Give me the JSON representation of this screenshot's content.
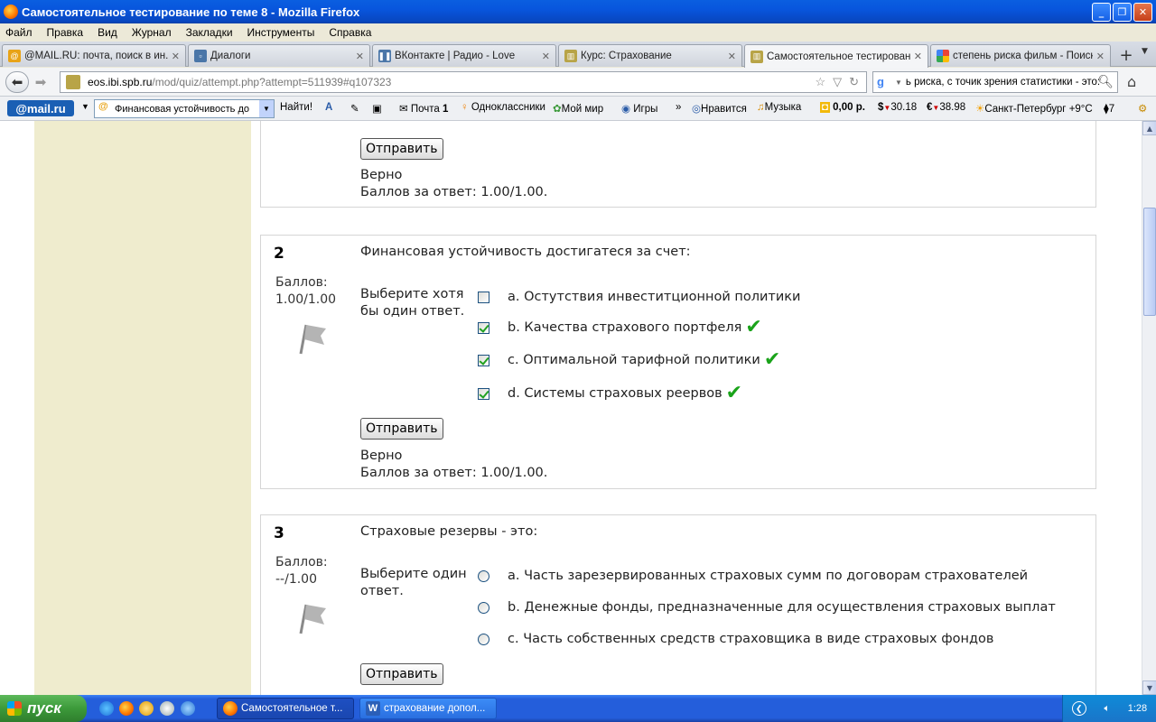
{
  "window": {
    "title": "Самостоятельное тестирование по теме 8 - Mozilla Firefox"
  },
  "menu": [
    "Файл",
    "Правка",
    "Вид",
    "Журнал",
    "Закладки",
    "Инструменты",
    "Справка"
  ],
  "tabs": [
    {
      "label": "@MAIL.RU: почта, поиск в ин...",
      "icon": "mailru-icon"
    },
    {
      "label": "Диалоги",
      "icon": "vk-icon"
    },
    {
      "label": "ВКонтакте | Радио - Love",
      "icon": "vk-icon"
    },
    {
      "label": "Курс: Страхование",
      "icon": "moodle-icon"
    },
    {
      "label": "Самостоятельное тестирован...",
      "icon": "moodle-icon"
    },
    {
      "label": "степень риска фильм - Поиск ...",
      "icon": "google-icon"
    }
  ],
  "nav": {
    "url_host": "eos.ibi.spb.ru",
    "url_path": "/mod/quiz/attempt.php?attempt=511939#q107323",
    "search_value": "ь риска, с точик зрения статистики - это:"
  },
  "mailbar": {
    "logo": "@mail.ru",
    "search_value": "Финансовая устойчивость до",
    "find_label": "Найти!",
    "items": [
      "Почта",
      "1",
      "Одноклассники",
      "Мой мир",
      "Игры",
      "»",
      "Нравится",
      "Музыка",
      "0,00 р.",
      "30.18",
      "38.98",
      "Санкт-Петербург +9°C",
      "7"
    ]
  },
  "quiz": {
    "prev": {
      "submit": "Отправить",
      "status": "Верно",
      "score": "Баллов за ответ: 1.00/1.00."
    },
    "q2": {
      "number": "2",
      "grade_label": "Баллов:",
      "grade_value": "1.00/1.00",
      "text": "Финансовая устойчивость достигатеся за счет:",
      "prompt": "Выберите хотя бы один ответ.",
      "answers": [
        {
          "label": "a. Остутствия инвеститционной политики",
          "checked": false,
          "correct": false
        },
        {
          "label": "b. Качества страхового портфеля",
          "checked": true,
          "correct": true
        },
        {
          "label": "c. Оптимальной тарифной политики",
          "checked": true,
          "correct": true
        },
        {
          "label": "d. Системы страховых реервов",
          "checked": true,
          "correct": true
        }
      ],
      "submit": "Отправить",
      "status": "Верно",
      "score": "Баллов за ответ: 1.00/1.00."
    },
    "q3": {
      "number": "3",
      "grade_label": "Баллов:",
      "grade_value": "--/1.00",
      "text": "Страховые резервы - это:",
      "prompt": "Выберите один ответ.",
      "answers": [
        {
          "label": "a. Часть зарезервированных страховых сумм по договорам страхователей"
        },
        {
          "label": "b. Денежные фонды, предназначенные для осуществления страховых выплат"
        },
        {
          "label": "c. Часть собственных средств страховщика в виде страховых фондов"
        }
      ],
      "submit": "Отправить"
    }
  },
  "taskbar": {
    "start": "пуск",
    "tasks": [
      "Самостоятельное т...",
      "страхование допол..."
    ],
    "lang": "RL",
    "clock": "1:28"
  },
  "colors": {
    "sidebar": "#efecce",
    "tick": "#1aa31a"
  }
}
